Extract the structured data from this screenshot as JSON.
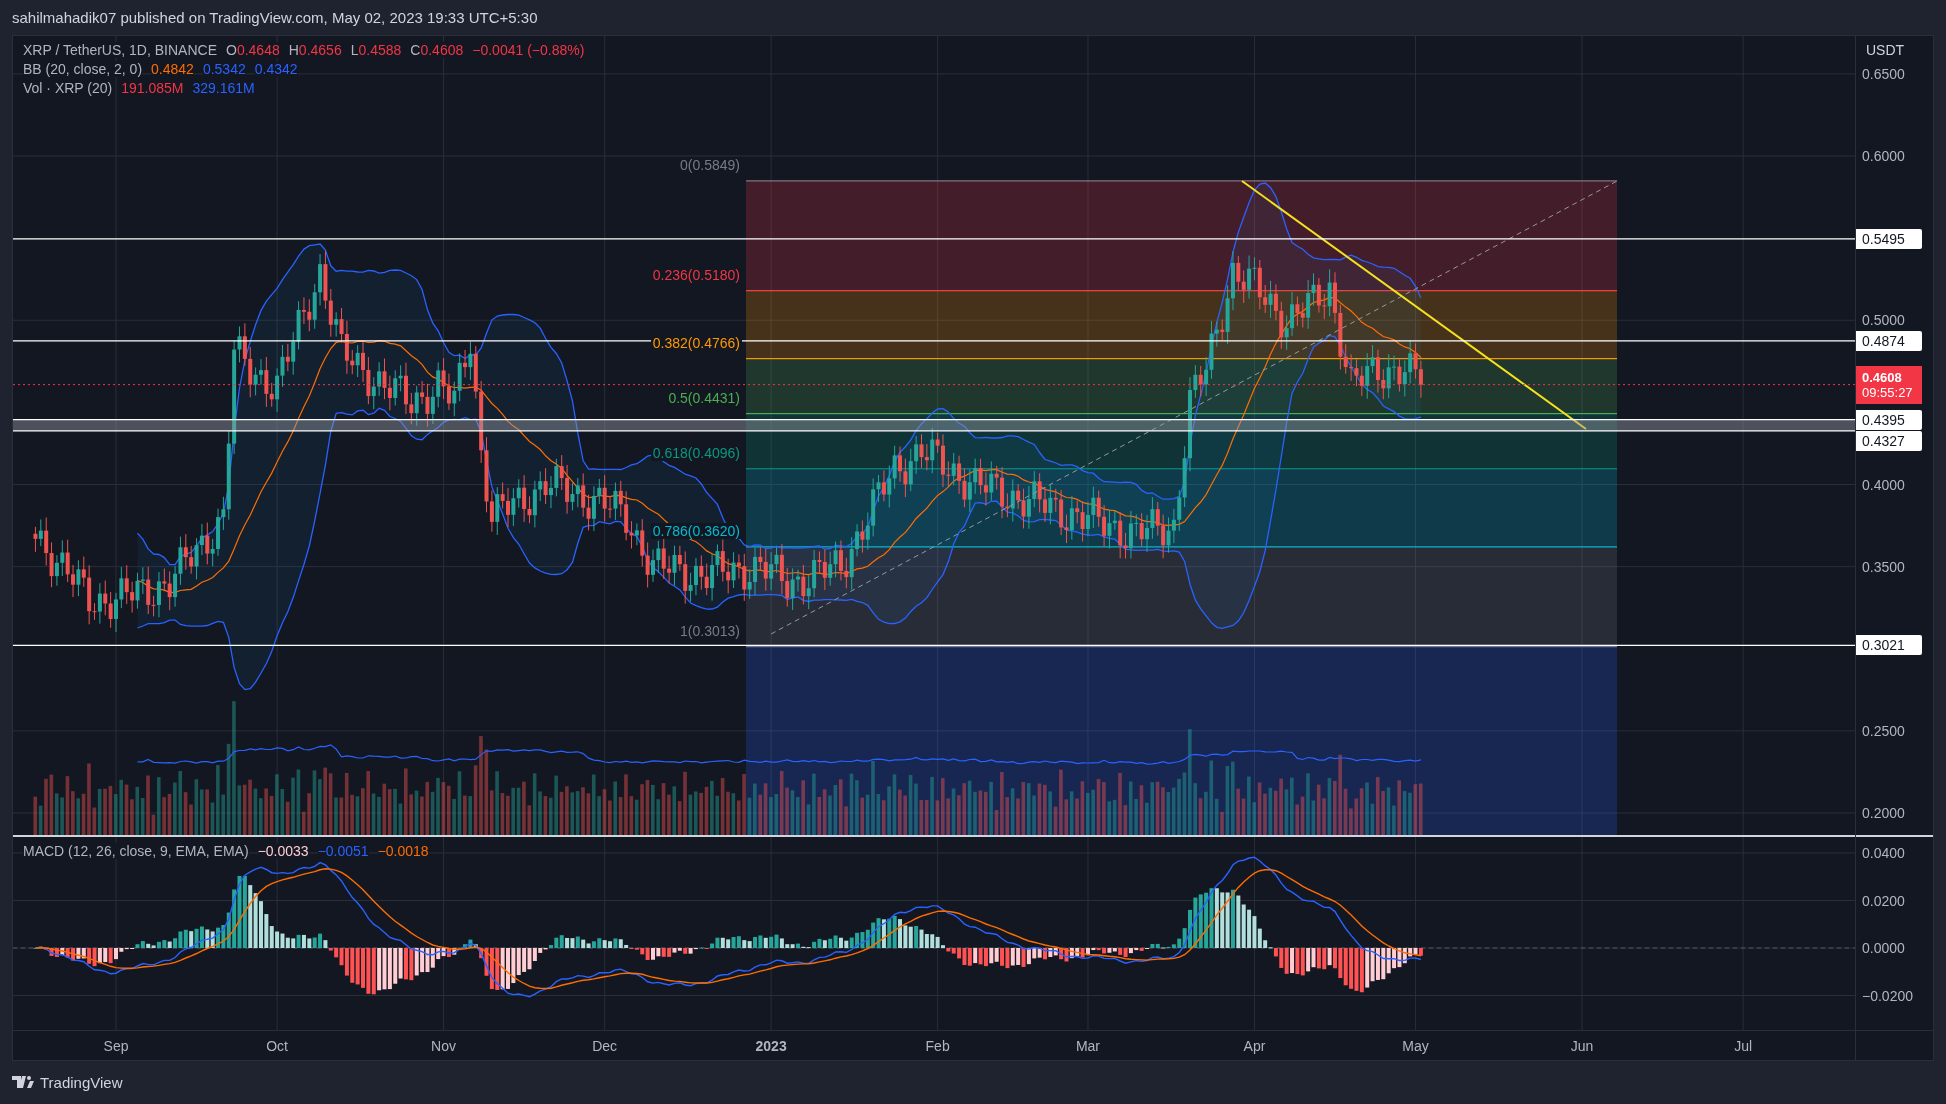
{
  "header": {
    "text": "sahilmahadik07 published on TradingView.com, May 02, 2023 19:33 UTC+5:30"
  },
  "legend": {
    "symbol": "XRP / TetherUS, 1D, BINANCE",
    "ohlc": [
      {
        "key": "O",
        "value": "0.4648"
      },
      {
        "key": "H",
        "value": "0.4656"
      },
      {
        "key": "L",
        "value": "0.4588"
      },
      {
        "key": "C",
        "value": "0.4608"
      }
    ],
    "change": "−0.0041 (−0.88%)",
    "indicators": [
      {
        "label": "BB (20, close, 2, 0)",
        "values": [
          {
            "text": "0.4842",
            "color": "#ff6d00"
          },
          {
            "text": "0.5342",
            "color": "#2962ff"
          },
          {
            "text": "0.4342",
            "color": "#2962ff"
          }
        ]
      },
      {
        "label": "Vol · XRP (20)",
        "values": [
          {
            "text": "191.085M",
            "color": "#f23645"
          },
          {
            "text": "329.161M",
            "color": "#2962ff"
          }
        ]
      }
    ]
  },
  "price_axis": {
    "unit": "USDT",
    "ticks": [
      "0.6500",
      "0.6000",
      "0.5000",
      "0.4000",
      "0.3500",
      "0.2500",
      "0.2000"
    ]
  },
  "horizontal_lines": [
    {
      "label": "0.5495"
    },
    {
      "label": "0.4874"
    },
    {
      "label": "0.3021"
    }
  ],
  "support_zone": {
    "top_label": "0.4395",
    "bottom_label": "0.4327"
  },
  "current_price": {
    "price": "0.4608",
    "countdown": "09:55:27"
  },
  "fib_levels": [
    {
      "label": "0(0.5849)",
      "color": "#787b86"
    },
    {
      "label": "0.236(0.5180)",
      "color": "#f23645"
    },
    {
      "label": "0.382(0.4766)",
      "color": "#ff9800"
    },
    {
      "label": "0.5(0.4431)",
      "color": "#4caf50"
    },
    {
      "label": "0.618(0.4096)",
      "color": "#089981"
    },
    {
      "label": "0.786(0.3620)",
      "color": "#00bcd4"
    },
    {
      "label": "1(0.3013)",
      "color": "#787b86"
    }
  ],
  "macd": {
    "label": "MACD (12, 26, close, 9, EMA, EMA)",
    "values": [
      {
        "text": "−0.0033",
        "color": "#ffcdd2"
      },
      {
        "text": "−0.0051",
        "color": "#2962ff"
      },
      {
        "text": "−0.0018",
        "color": "#ff6d00"
      }
    ],
    "ticks": [
      "0.0400",
      "0.0200",
      "0.0000",
      "−0.0200"
    ]
  },
  "time_axis": [
    {
      "label": "Sep",
      "kind": "month"
    },
    {
      "label": "Oct",
      "kind": "month"
    },
    {
      "label": "Nov",
      "kind": "month"
    },
    {
      "label": "Dec",
      "kind": "month"
    },
    {
      "label": "2023",
      "kind": "year"
    },
    {
      "label": "Feb",
      "kind": "month"
    },
    {
      "label": "Mar",
      "kind": "month"
    },
    {
      "label": "Apr",
      "kind": "month"
    },
    {
      "label": "May",
      "kind": "month"
    },
    {
      "label": "Jun",
      "kind": "month"
    },
    {
      "label": "Jul",
      "kind": "month"
    }
  ],
  "footer": {
    "brand": "TradingView"
  }
}
